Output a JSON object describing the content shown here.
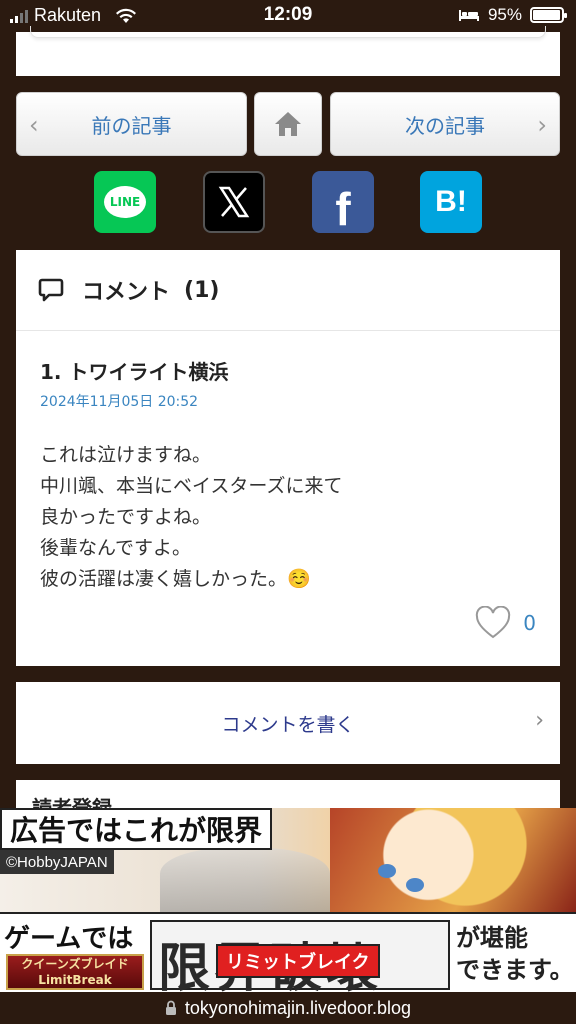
{
  "status_bar": {
    "carrier": "Rakuten",
    "time": "12:09",
    "battery": "95%",
    "battery_level": 0.95
  },
  "nav": {
    "prev_label": "前の記事",
    "next_label": "次の記事"
  },
  "share": {
    "line_label": "LINE",
    "x_label": "𝕏",
    "facebook_label": "f",
    "hatena_label": "B!"
  },
  "comments": {
    "title": "コメント",
    "count": "(1)",
    "items": [
      {
        "name": "1. トワイライト横浜",
        "date": "2024年11月05日 20:52",
        "lines": [
          "これは泣けますね。",
          "中川颯、本当にベイスターズに来て",
          "良かったですよね。",
          "後輩なんですよ。",
          "彼の活躍は凄く嬉しかった。☺️"
        ],
        "likes": "0"
      }
    ]
  },
  "write_comment": {
    "label": "コメントを書く"
  },
  "reader": {
    "label": "読者登録"
  },
  "ad": {
    "headline": "広告ではこれが限界",
    "copyright": "©HobbyJAPAN",
    "game_text": "ゲームでは",
    "logo_text": "クイーンズブレイド LimitBreak",
    "big_text": "限界破壊",
    "ribbon_text": "リミットブレイク",
    "tail_line1": "が堪能",
    "tail_line2": "できます。"
  },
  "url_bar": {
    "url": "tokyonohimajin.livedoor.blog"
  },
  "colors": {
    "background": "#2b1a10",
    "link_blue": "#3a78b8",
    "line_green": "#06c755",
    "facebook_blue": "#3b5998",
    "hatena_blue": "#00a4de"
  }
}
